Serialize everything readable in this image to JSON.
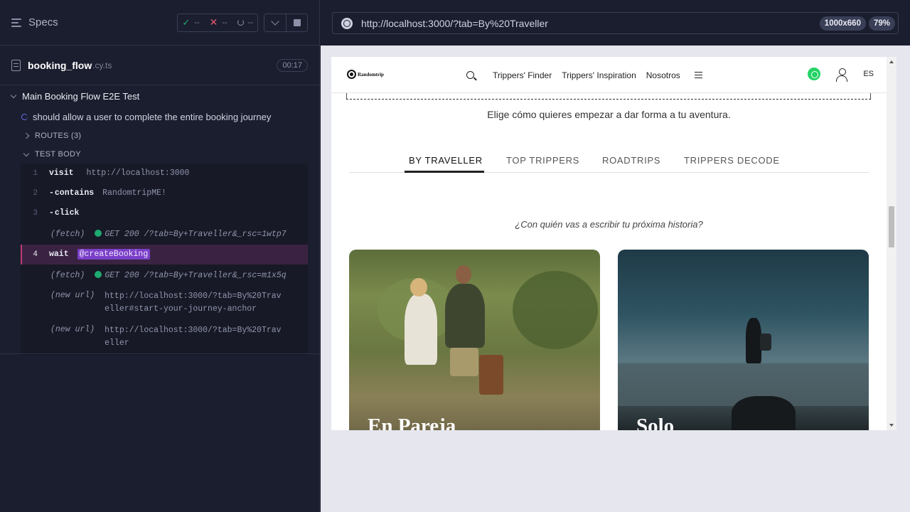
{
  "reporter": {
    "specs_label": "Specs",
    "stats": {
      "passed": "--",
      "failed": "--",
      "pending": "--"
    },
    "file": {
      "name": "booking_flow",
      "ext": ".cy.ts",
      "duration": "00:17"
    },
    "suite_title": "Main Booking Flow E2E Test",
    "test_title": "should allow a user to complete the entire booking journey",
    "routes_label": "ROUTES (3)",
    "body_label": "TEST BODY",
    "commands": [
      {
        "num": "1",
        "name": "visit",
        "msg": "http://localhost:3000"
      },
      {
        "num": "2",
        "name": "contains",
        "msg": "RandomtripME!"
      },
      {
        "num": "3",
        "name": "click",
        "msg": ""
      }
    ],
    "fetch1": {
      "tag": "(fetch)",
      "txt": "GET 200 /?tab=By+Traveller&_rsc=1wtp7"
    },
    "wait_cmd": {
      "num": "4",
      "name": "wait",
      "alias": "@createBooking"
    },
    "fetch2": {
      "tag": "(fetch)",
      "txt": "GET 200 /?tab=By+Traveller&_rsc=m1x5q"
    },
    "url1": {
      "tag": "(new url)",
      "txt": "http://localhost:3000/?tab=By%20Traveller#start-your-journey-anchor"
    },
    "url2": {
      "tag": "(new url)",
      "txt": "http://localhost:3000/?tab=By%20Traveller"
    }
  },
  "aut": {
    "url": "http://localhost:3000/?tab=By%20Traveller",
    "viewport": "1000x660",
    "zoom": "79%"
  },
  "site": {
    "logo": "Randomtrip",
    "nav": [
      "Trippers' Finder",
      "Trippers' Inspiration",
      "Nosotros"
    ],
    "lang": "ES",
    "subtitle": "Elige cómo quieres empezar a dar forma a tu aventura.",
    "tabs": [
      "BY TRAVELLER",
      "TOP TRIPPERS",
      "ROADTRIPS",
      "TRIPPERS DECODE"
    ],
    "question": "¿Con quién vas a escribir tu próxima historia?",
    "cards": [
      "En Pareja",
      "Solo"
    ]
  },
  "colors": {
    "accent_pass": "#1fa971",
    "accent_fail": "#e45770",
    "active_cmd_bg": "#3a2342",
    "alias_bg": "#7a3fc7"
  }
}
